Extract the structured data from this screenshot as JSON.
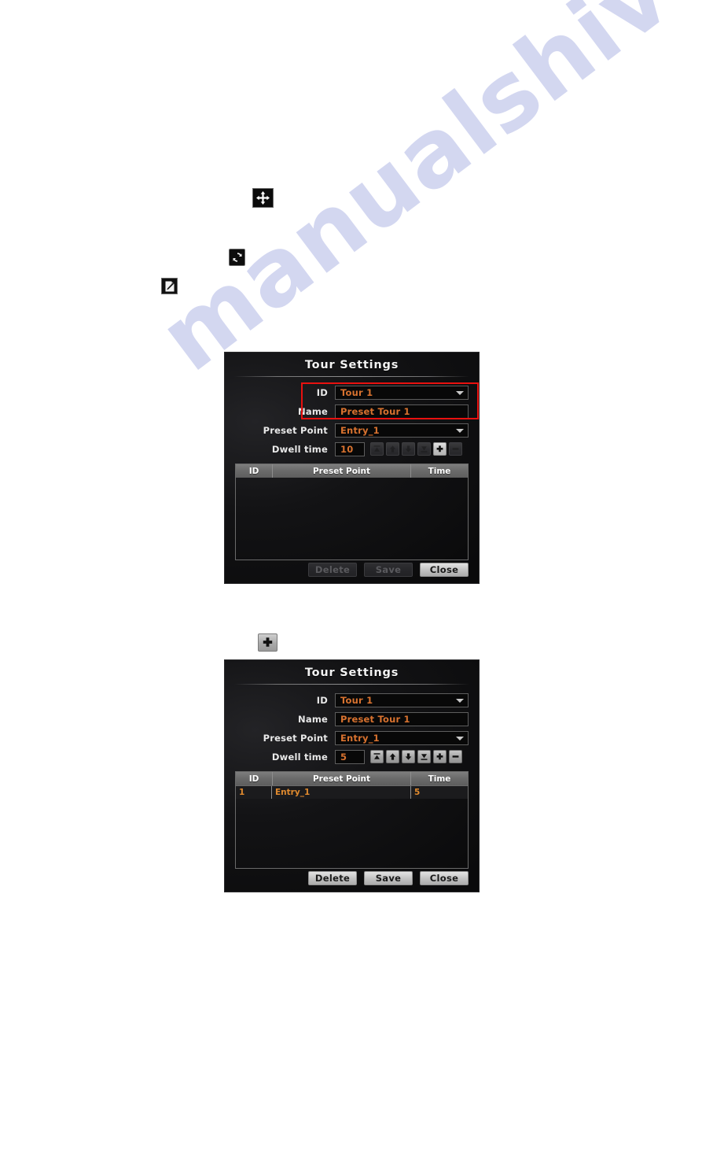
{
  "page": {
    "watermark": "manualshive.com",
    "background_color": "#ffffff"
  },
  "standalone_icons": [
    {
      "name": "pan-tilt-move-icon",
      "glyph": "four-way-arrows",
      "label": "Move"
    },
    {
      "name": "auto-scan-refresh-icon",
      "glyph": "circular-arrows",
      "label": "Refresh"
    },
    {
      "name": "preset-edit-page-icon",
      "glyph": "page-with-pen",
      "label": "Edit"
    },
    {
      "name": "add-plus-icon",
      "glyph": "plus",
      "label": "Add"
    }
  ],
  "dialogs": [
    {
      "id": "dialog-initial",
      "title": "Tour Settings",
      "fields": {
        "id": {
          "label": "ID",
          "value": "Tour 1",
          "type": "dropdown"
        },
        "name": {
          "label": "Name",
          "value": "Preset Tour 1",
          "type": "text"
        },
        "preset_point": {
          "label": "Preset Point",
          "value": "Entry_1",
          "type": "dropdown"
        },
        "dwell_time": {
          "label": "Dwell time",
          "value": "10",
          "type": "text"
        }
      },
      "stepper_buttons": [
        {
          "name": "move-to-top-button",
          "glyph": "bar-arrow-up",
          "enabled": false
        },
        {
          "name": "move-up-button",
          "glyph": "arrow-up",
          "enabled": false
        },
        {
          "name": "move-down-button",
          "glyph": "arrow-down",
          "enabled": false
        },
        {
          "name": "move-to-bottom-button",
          "glyph": "bar-arrow-down",
          "enabled": false
        },
        {
          "name": "add-row-button",
          "glyph": "plus",
          "enabled": true
        },
        {
          "name": "remove-row-button",
          "glyph": "minus",
          "enabled": false
        }
      ],
      "table": {
        "columns": [
          "ID",
          "Preset Point",
          "Time"
        ],
        "rows": []
      },
      "footer_buttons": [
        {
          "name": "delete-button",
          "label": "Delete",
          "enabled": false
        },
        {
          "name": "save-button",
          "label": "Save",
          "enabled": false
        },
        {
          "name": "close-button",
          "label": "Close",
          "enabled": true
        }
      ],
      "highlight": {
        "color": "#e8110f",
        "targets": [
          "ID",
          "Name"
        ]
      }
    },
    {
      "id": "dialog-after-add",
      "title": "Tour Settings",
      "fields": {
        "id": {
          "label": "ID",
          "value": "Tour 1",
          "type": "dropdown"
        },
        "name": {
          "label": "Name",
          "value": "Preset Tour 1",
          "type": "text"
        },
        "preset_point": {
          "label": "Preset Point",
          "value": "Entry_1",
          "type": "dropdown"
        },
        "dwell_time": {
          "label": "Dwell time",
          "value": "5",
          "type": "text"
        }
      },
      "stepper_buttons": [
        {
          "name": "move-to-top-button",
          "glyph": "bar-arrow-up",
          "enabled": true
        },
        {
          "name": "move-up-button",
          "glyph": "arrow-up",
          "enabled": true
        },
        {
          "name": "move-down-button",
          "glyph": "arrow-down",
          "enabled": true
        },
        {
          "name": "move-to-bottom-button",
          "glyph": "bar-arrow-down",
          "enabled": true
        },
        {
          "name": "add-row-button",
          "glyph": "plus",
          "enabled": true
        },
        {
          "name": "remove-row-button",
          "glyph": "minus",
          "enabled": true
        }
      ],
      "table": {
        "columns": [
          "ID",
          "Preset Point",
          "Time"
        ],
        "rows": [
          {
            "id": "1",
            "preset_point": "Entry_1",
            "time": "5"
          }
        ]
      },
      "footer_buttons": [
        {
          "name": "delete-button",
          "label": "Delete",
          "enabled": true
        },
        {
          "name": "save-button",
          "label": "Save",
          "enabled": true
        },
        {
          "name": "close-button",
          "label": "Close",
          "enabled": true
        }
      ]
    }
  ],
  "colors": {
    "value_orange": "#d8722f",
    "row_orange": "#e08a2e",
    "highlight_red": "#e8110f",
    "dialog_bg": "#131315",
    "watermark": "#b9bfe8"
  }
}
